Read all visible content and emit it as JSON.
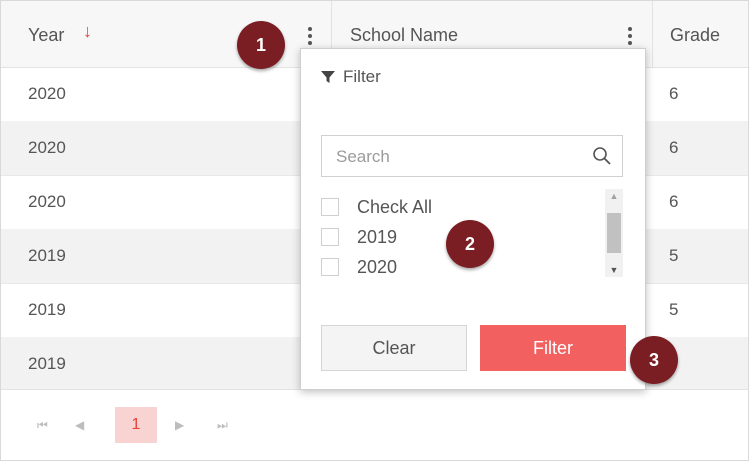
{
  "columns": {
    "year": "Year",
    "school_name": "School Name",
    "grade": "Grade"
  },
  "rows": [
    {
      "year": "2020",
      "grade": "6"
    },
    {
      "year": "2020",
      "grade": "6"
    },
    {
      "year": "2020",
      "grade": "6"
    },
    {
      "year": "2019",
      "grade": "5"
    },
    {
      "year": "2019",
      "grade": "5"
    },
    {
      "year": "2019",
      "grade": ""
    }
  ],
  "sort_indicator": "↓",
  "filter_popup": {
    "title": "Filter",
    "search_placeholder": "Search",
    "options": [
      "Check All",
      "2019",
      "2020"
    ],
    "clear_label": "Clear",
    "filter_label": "Filter"
  },
  "pager": {
    "first": "⏮",
    "prev": "◀",
    "current": "1",
    "next": "▶",
    "last": "⏭"
  },
  "callouts": [
    "1",
    "2",
    "3"
  ],
  "colors": {
    "accent": "#e8403a",
    "filter_button": "#f26060",
    "callout": "#7a1e24",
    "current_page_bg": "#f9d3d1"
  }
}
